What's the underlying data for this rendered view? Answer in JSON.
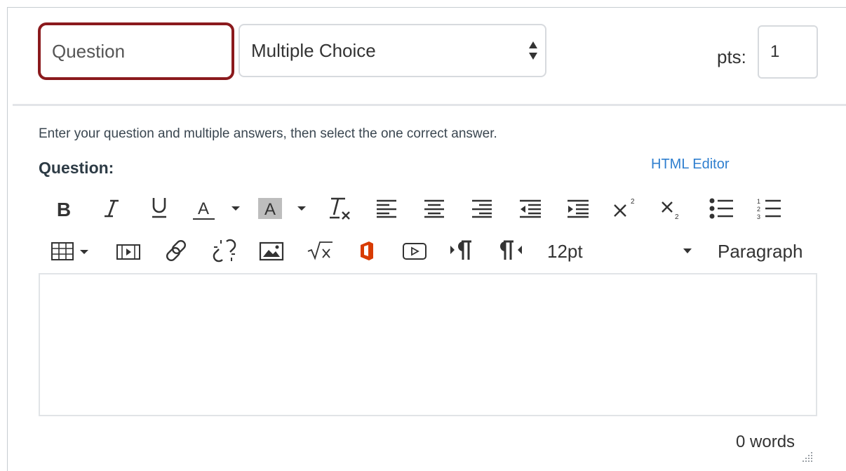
{
  "header": {
    "question_name": "Question",
    "question_type": "Multiple Choice",
    "points_label": "pts:",
    "points_value": "1"
  },
  "instructions": "Enter your question and multiple answers, then select the one correct answer.",
  "question_label": "Question:",
  "html_editor_link": "HTML Editor",
  "toolbar": {
    "row1": [
      "bold-icon",
      "italic-icon",
      "underline-icon",
      "text-color-icon",
      "background-color-icon",
      "clear-formatting-icon",
      "align-left-icon",
      "align-center-icon",
      "align-right-icon",
      "outdent-icon",
      "indent-icon",
      "superscript-icon",
      "subscript-icon",
      "bullet-list-icon",
      "numbered-list-icon"
    ],
    "row2": [
      "table-icon",
      "media-icon",
      "link-icon",
      "unlink-icon",
      "image-icon",
      "equation-icon",
      "office-icon",
      "video-icon",
      "ltr-icon",
      "rtl-icon"
    ],
    "font_size": "12pt",
    "paragraph": "Paragraph",
    "colors": {
      "text_color_underline": "#333333",
      "office_orange": "#d83b01"
    }
  },
  "editor": {
    "content": ""
  },
  "word_count": "0 words",
  "colors": {
    "focus_border": "#8b1a1d",
    "link": "#2f7fcf"
  }
}
